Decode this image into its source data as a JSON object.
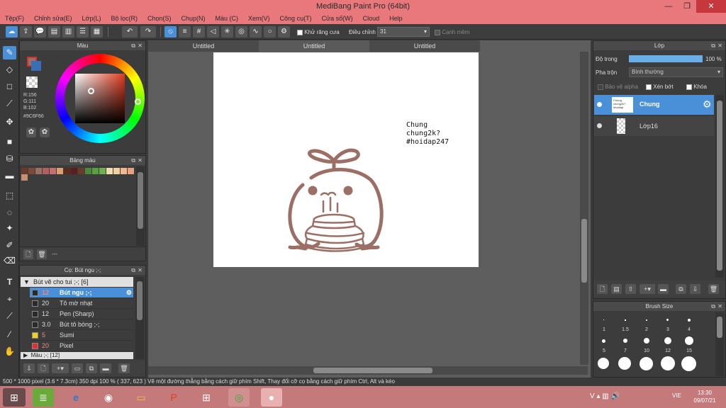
{
  "window": {
    "title": "MediBang Paint Pro (64bit)"
  },
  "menu": [
    "Tệp(F)",
    "Chỉnh sửa(E)",
    "Lớp(L)",
    "Bộ lọc(R)",
    "Chọn(S)",
    "Chụp(N)",
    "Màu (C)",
    "Xem(V)",
    "Công cụ(T)",
    "Cửa số(W)",
    "Cloud",
    "Help"
  ],
  "toolbar": {
    "antialias_label": "Khử răng cưa",
    "correction_label": "Điều chỉnh",
    "correction_value": "31",
    "soft_edge_label": "Cạnh mềm"
  },
  "color_panel": {
    "title": "Màu",
    "r": "R:156",
    "g": "G:111",
    "b": "B:102",
    "hex": "#9C6F66",
    "fg_color": "#9C6F66",
    "bg_color": "#3b6fb5"
  },
  "palette_panel": {
    "title": "Bảng màu",
    "swatches": [
      "#6b3a2a",
      "#7a4a3a",
      "#9c6f66",
      "#b06060",
      "#c87070",
      "#d9a070",
      "#5a2a1a",
      "#5a1e1e",
      "#6a3a2a",
      "#4a8a3a",
      "#5aa040",
      "#70b050",
      "#f0e0b0",
      "#f0d0a0",
      "#f0b890",
      "#e8a080",
      "#c89070"
    ],
    "footer_text": "---"
  },
  "brush_panel": {
    "title": "Cọ: Bút ngu ;-;",
    "group_label": "Bút vẽ cho tui ;-; [6]",
    "items": [
      {
        "size": "12",
        "name": "Bút ngu ;-;",
        "color": "#2a2a2a",
        "selected": true
      },
      {
        "size": "20",
        "name": "Tô mờ nhạt",
        "color": "#2a2a2a",
        "selected": false
      },
      {
        "size": "12",
        "name": "Pen (Sharp)",
        "color": "#2a2a2a",
        "selected": false
      },
      {
        "size": "3.0",
        "name": "Bút tô bóng ;-;",
        "color": "#2a2a2a",
        "selected": false
      },
      {
        "size": "5",
        "name": "Sumi",
        "color": "#f0d020",
        "selected": false
      },
      {
        "size": "20",
        "name": "Pixel",
        "color": "#e03030",
        "selected": false
      }
    ],
    "group2_label": "Màu ;-; [12]"
  },
  "doc_tabs": [
    "Untitled",
    "Untitled",
    "Untitled"
  ],
  "canvas": {
    "text_lines": [
      "Chung",
      "chung2k?",
      "#hoidap247"
    ]
  },
  "layer_panel": {
    "title": "Lớp",
    "opacity_label": "Độ trong",
    "opacity_value": "100 %",
    "opacity": 1.0,
    "blend_label": "Pha trộn",
    "blend_value": "Bình thường",
    "protect_alpha": "Bảo vệ alpha",
    "clipping": "Xén bớt",
    "lock": "Khóa",
    "layers": [
      {
        "name": "Chung",
        "selected": true
      },
      {
        "name": "Lớp16",
        "selected": false
      }
    ]
  },
  "brush_size_panel": {
    "title": "Brush Size",
    "rows": [
      [
        "1",
        "1.5",
        "2",
        "3",
        "4"
      ],
      [
        "5",
        "7",
        "10",
        "12",
        "15"
      ]
    ]
  },
  "status": {
    "text": "500 * 1000 pixel   (3.6 * 7.3cm)   350 dpi   100 %   ( 337, 623 )   Vẽ một đường thẳng bằng cách giữ phím Shift, Thay đổi cỡ cọ bằng cách giữ phím Ctrl, Alt và kéo"
  },
  "taskbar": {
    "lang": "VIE",
    "time": "13:30",
    "date": "09/07/21"
  },
  "colors": {
    "titlebar": "#e8787c",
    "accent_blue": "#4a90d9",
    "drawing": "#9c6f66"
  }
}
